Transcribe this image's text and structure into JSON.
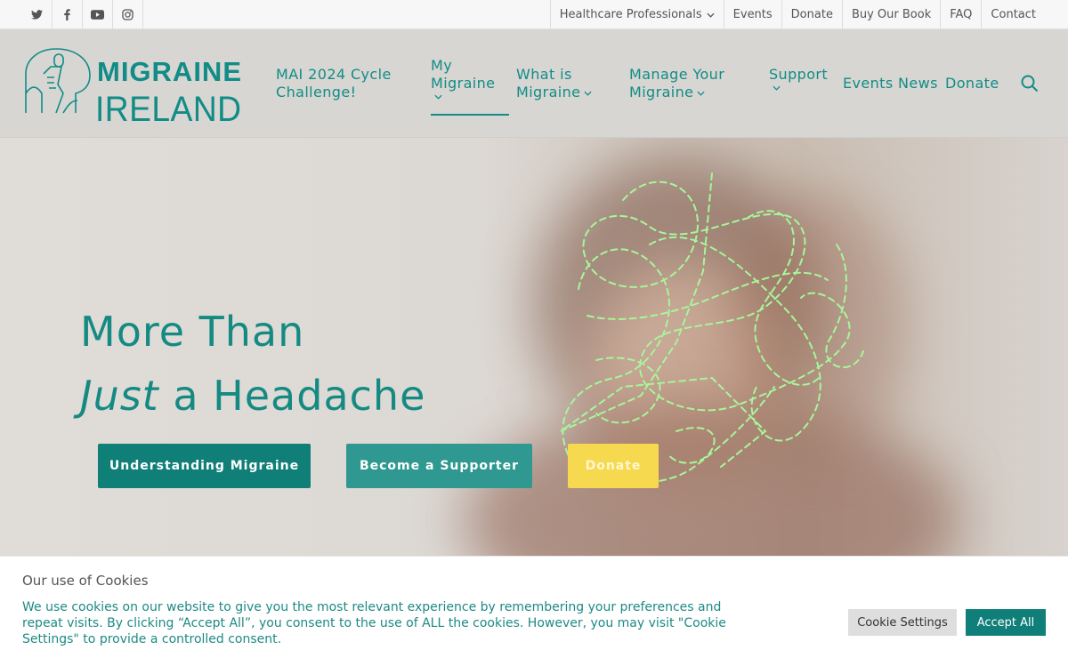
{
  "topbar": {
    "social": [
      "twitter-icon",
      "facebook-icon",
      "youtube-icon",
      "instagram-icon"
    ],
    "links": [
      "Healthcare Professionals",
      "Events",
      "Donate",
      "Buy Our Book",
      "FAQ",
      "Contact"
    ]
  },
  "logo": {
    "line1": "MIGRAINE",
    "line2": "IRELAND"
  },
  "nav": {
    "cycle": [
      "MAI 2024 Cycle",
      "Challenge!"
    ],
    "my": [
      "My",
      "Migraine"
    ],
    "what": [
      "What is",
      "Migraine"
    ],
    "manage": [
      "Manage Your",
      "Migraine"
    ],
    "support": "Support",
    "events": "Events",
    "news": "News",
    "donate": "Donate"
  },
  "hero": {
    "line1": "More Than",
    "line2_em": "Just",
    "line2_rest": " a Headache",
    "buttons": [
      "Understanding Migraine",
      "Become a Supporter",
      "Donate"
    ]
  },
  "cookie": {
    "title": "Our use of Cookies",
    "text": "We use cookies on our website to give you the most relevant experience by remembering your preferences and repeat visits. By clicking “Accept All”, you consent to the use of ALL the cookies. However, you may visit \"Cookie Settings\" to provide a controlled consent.",
    "settings": "Cookie Settings",
    "accept": "Accept All"
  },
  "colors": {
    "brand": "#118c86",
    "accent": "#f7d94f",
    "scribble": "#a8f59a"
  }
}
